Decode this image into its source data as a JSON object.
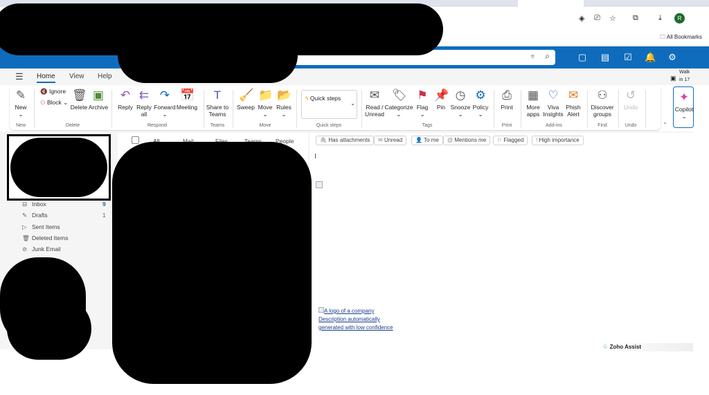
{
  "browser": {
    "bookmarks_label": "All Bookmarks",
    "profile_initial": "R"
  },
  "ribbon_tabs": [
    "Home",
    "View",
    "Help"
  ],
  "walk": {
    "title": "Walk",
    "sub": "in 17"
  },
  "ribbon_buttons": [
    {
      "label": "New",
      "sub": "⌄",
      "icon": "new-mail-icon",
      "glyph": "✎"
    },
    {
      "label": "Delete",
      "icon": "trash-icon",
      "glyph": "🗑"
    },
    {
      "label": "Archive",
      "icon": "archive-icon",
      "glyph": "▣"
    },
    {
      "label": "Reply",
      "icon": "reply-icon",
      "glyph": "↶"
    },
    {
      "label": "Reply",
      "sub": "all",
      "icon": "reply-all-icon",
      "glyph": "⇇"
    },
    {
      "label": "Forward",
      "sub": "⌄",
      "icon": "forward-icon",
      "glyph": "↷"
    },
    {
      "label": "Meeting",
      "icon": "meeting-icon",
      "glyph": "📅"
    },
    {
      "label": "Share to",
      "sub": "Teams",
      "icon": "teams-icon",
      "glyph": "T"
    },
    {
      "label": "Sweep",
      "icon": "sweep-icon",
      "glyph": "🧹"
    },
    {
      "label": "Move",
      "sub": "⌄",
      "icon": "move-icon",
      "glyph": "📁"
    },
    {
      "label": "Rules",
      "sub": "⌄",
      "icon": "rules-icon",
      "glyph": "📂"
    },
    {
      "label": "Read /",
      "sub": "Unread",
      "icon": "envelope-open-icon",
      "glyph": "✉"
    },
    {
      "label": "Categorize",
      "sub": "⌄",
      "icon": "tag-icon",
      "glyph": "🏷"
    },
    {
      "label": "Flag",
      "sub": "⌄",
      "icon": "flag-icon",
      "glyph": "⚑"
    },
    {
      "label": "Pin",
      "icon": "pin-icon",
      "glyph": "📌"
    },
    {
      "label": "Snooze",
      "sub": "⌄",
      "icon": "clock-icon",
      "glyph": "◷"
    },
    {
      "label": "Policy",
      "sub": "⌄",
      "icon": "policy-icon",
      "glyph": "⚙"
    },
    {
      "label": "Print",
      "icon": "printer-icon",
      "glyph": "⎙"
    },
    {
      "label": "More",
      "sub": "apps",
      "icon": "apps-icon",
      "glyph": "▦"
    },
    {
      "label": "Viva",
      "sub": "Insights",
      "icon": "viva-icon",
      "glyph": "♡"
    },
    {
      "label": "Phish",
      "sub": "Alert",
      "icon": "phish-icon",
      "glyph": "✉"
    },
    {
      "label": "Discover",
      "sub": "groups",
      "icon": "groups-icon",
      "glyph": "⚇"
    },
    {
      "label": "Undo",
      "icon": "undo-icon",
      "glyph": "↺"
    },
    {
      "label": "Copilot",
      "sub": "⌄",
      "icon": "copilot-icon",
      "glyph": "✦"
    }
  ],
  "small_buttons": {
    "ignore": "Ignore",
    "block": "Block ⌄",
    "quick_steps": "Quick steps"
  },
  "groups": [
    "New",
    "Delete",
    "Respond",
    "Teams",
    "Move",
    "Quick steps",
    "Tags",
    "Print",
    "Add-ins",
    "Find",
    "Undo"
  ],
  "folders": [
    {
      "name": "Inbox",
      "count": "9",
      "icon": "inbox-icon",
      "glyph": "⊟"
    },
    {
      "name": "Drafts",
      "count": "1",
      "icon": "pencil-icon",
      "glyph": "✎"
    },
    {
      "name": "Sent Items",
      "icon": "send-icon",
      "glyph": "▷"
    },
    {
      "name": "Deleted Items",
      "icon": "trash-icon",
      "glyph": "🗑"
    },
    {
      "name": "Junk Email",
      "icon": "junk-icon",
      "glyph": "⊘"
    }
  ],
  "list_tabs": [
    "All",
    "Mail",
    "Files",
    "Teams",
    "People"
  ],
  "filters": [
    {
      "label": "Has attachments",
      "glyph": "🖇"
    },
    {
      "label": "Unread",
      "glyph": "✉"
    },
    {
      "label": "To me",
      "glyph": "👤"
    },
    {
      "label": "Mentions me",
      "glyph": "@"
    },
    {
      "label": "Flagged",
      "glyph": "⚐"
    },
    {
      "label": "High importance",
      "glyph": "!"
    }
  ],
  "reading": {
    "image_alt": "A logo of a company Description automatically generated with low confidence"
  },
  "zoho": "Zoho Assist"
}
